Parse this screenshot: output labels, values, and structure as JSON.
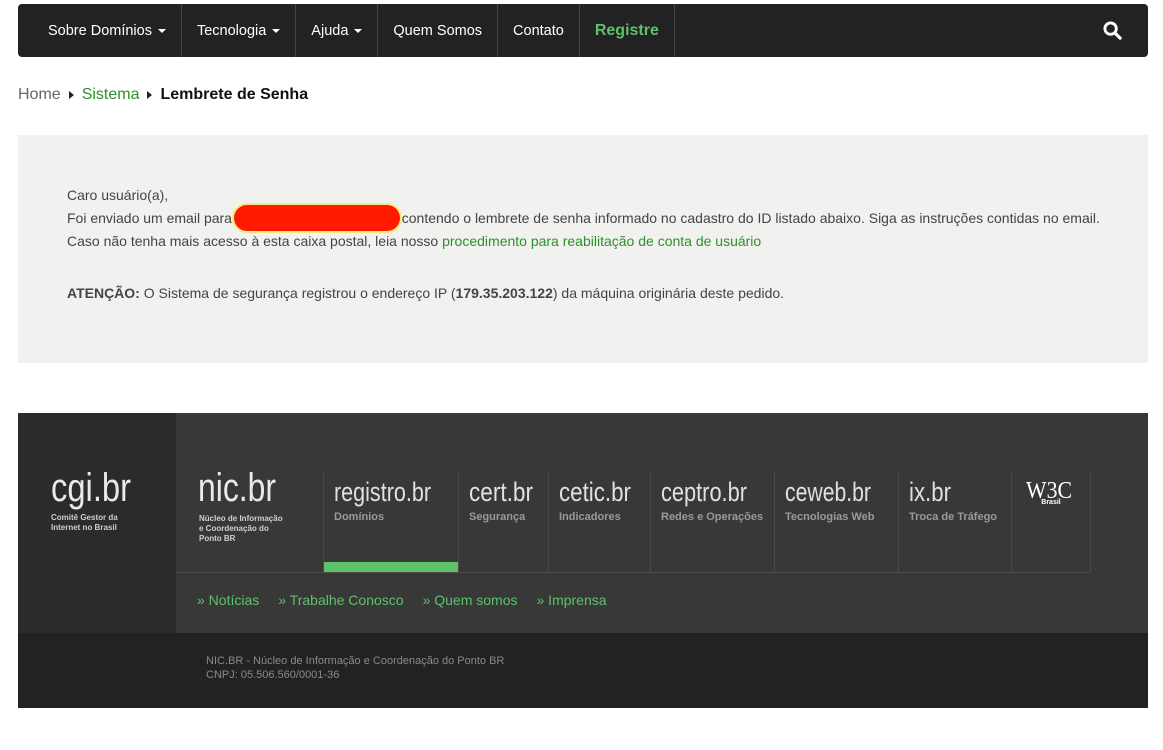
{
  "nav": {
    "items": [
      {
        "label": "Sobre Domínios",
        "dropdown": true
      },
      {
        "label": "Tecnologia",
        "dropdown": true
      },
      {
        "label": "Ajuda",
        "dropdown": true
      },
      {
        "label": "Quem Somos",
        "dropdown": false
      },
      {
        "label": "Contato",
        "dropdown": false
      }
    ],
    "register_label": "Registre",
    "search_icon": "search-icon"
  },
  "breadcrumb": {
    "home": "Home",
    "section": "Sistema",
    "current": "Lembrete de Senha"
  },
  "message": {
    "greeting": "Caro usuário(a),",
    "line2_before": "Foi enviado um email para",
    "line2_after": "contendo o lembrete de senha informado no cadastro do ID listado abaixo. Siga as instruções contidas no email.",
    "line3_before": "Caso não tenha mais acesso à esta caixa postal, leia nosso",
    "line3_link": "procedimento para reabilitação de conta de usuário",
    "attention_label": "ATENÇÃO:",
    "attention_before": "O Sistema de segurança registrou o endereço IP (",
    "attention_ip": "179.35.203.122",
    "attention_after": ") da máquina originária deste pedido."
  },
  "footer": {
    "cgi": {
      "logo": "cgi.br",
      "subtitle_1": "Comitê Gestor da",
      "subtitle_2": "Internet no Brasil"
    },
    "nic": {
      "logo": "nic.br",
      "subtitle_1": "Núcleo de Informação",
      "subtitle_2": "e Coordenação do",
      "subtitle_3": "Ponto BR"
    },
    "brands": [
      {
        "logo": "registro.br",
        "sub": "Domínios"
      },
      {
        "logo": "cert.br",
        "sub": "Segurança"
      },
      {
        "logo": "cetic.br",
        "sub": "Indicadores"
      },
      {
        "logo": "ceptro.br",
        "sub": "Redes e Operações"
      },
      {
        "logo": "ceweb.br",
        "sub": "Tecnologias Web"
      },
      {
        "logo": "ix.br",
        "sub": "Troca de Tráfego"
      },
      {
        "logo": "W3C",
        "sub": "Brasil"
      }
    ],
    "links": [
      "» Notícias",
      "» Trabalhe Conosco",
      "» Quem somos",
      "» Imprensa"
    ],
    "copy_line1": "NIC.BR - Núcleo de Informação e Coordenação do Ponto BR",
    "copy_line2": "CNPJ: 05.506.560/0001-36"
  },
  "colors": {
    "accent": "#5ec26a",
    "link": "#2f8f2a",
    "navbar_bg": "#222222",
    "redaction": "#ff1a00"
  }
}
